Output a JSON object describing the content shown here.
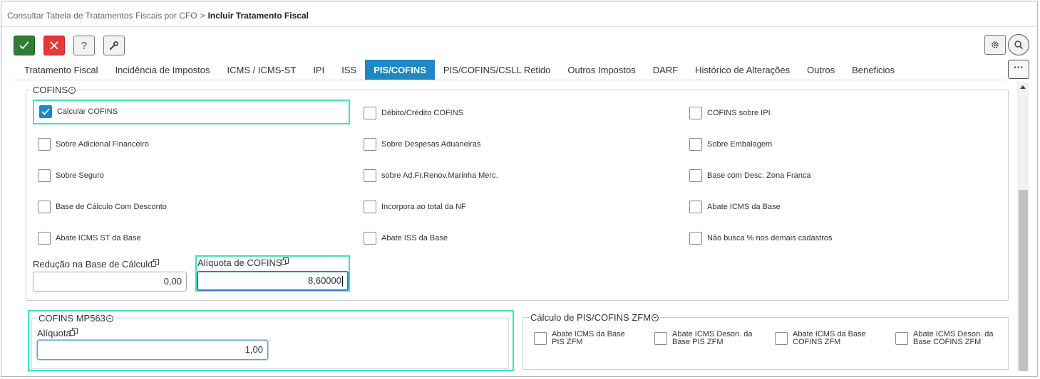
{
  "breadcrumb": {
    "parent": "Consultar Tabela de Tratamentos Fiscais por CFO",
    "separator": ">",
    "current": "Incluir Tratamento Fiscal"
  },
  "toolbar": {
    "confirm_icon": "check-icon",
    "cancel_icon": "close-icon",
    "help_label": "?",
    "tool_icon": "wrench-icon"
  },
  "top_right": {
    "settings_icon": "gear-icon",
    "search_icon": "search-icon",
    "more_label": "···"
  },
  "tabs": [
    {
      "label": "Tratamento Fiscal",
      "active": false
    },
    {
      "label": "Incidência de Impostos",
      "active": false
    },
    {
      "label": "ICMS / ICMS-ST",
      "active": false
    },
    {
      "label": "IPI",
      "active": false
    },
    {
      "label": "ISS",
      "active": false
    },
    {
      "label": "PIS/COFINS",
      "active": true
    },
    {
      "label": "PIS/COFINS/CSLL Retido",
      "active": false
    },
    {
      "label": "Outros Impostos",
      "active": false
    },
    {
      "label": "DARF",
      "active": false
    },
    {
      "label": "Histórico de Alterações",
      "active": false
    },
    {
      "label": "Outros",
      "active": false
    },
    {
      "label": "Beneficios",
      "active": false
    }
  ],
  "cofins": {
    "legend": "COFINS",
    "checkboxes": [
      {
        "label": "Calcular COFINS",
        "checked": true
      },
      {
        "label": "Débito/Crédito COFINS",
        "checked": false
      },
      {
        "label": "COFINS sobre IPI",
        "checked": false
      },
      {
        "label": "Sobre Adicional Financeiro",
        "checked": false
      },
      {
        "label": "Sobre Despesas Aduaneiras",
        "checked": false
      },
      {
        "label": "Sobre Embalagem",
        "checked": false
      },
      {
        "label": "Sobre Seguro",
        "checked": false
      },
      {
        "label": "sobre Ad.Fr.Renov.Marinha Merc.",
        "checked": false
      },
      {
        "label": "Base com Desc. Zona Franca",
        "checked": false
      },
      {
        "label": "Base de Cálculo Com Desconto",
        "checked": false
      },
      {
        "label": "Incorpora ao total da NF",
        "checked": false
      },
      {
        "label": "Abate ICMS da Base",
        "checked": false
      },
      {
        "label": "Abate ICMS ST da Base",
        "checked": false
      },
      {
        "label": "Abate ISS da Base",
        "checked": false
      },
      {
        "label": "Não busca % nos demais cadastros",
        "checked": false
      }
    ],
    "reducao_label": "Redução na Base de Cálculo",
    "reducao_value": "0,00",
    "aliquota_label": "Alíquota de COFINS",
    "aliquota_value": "8,60000"
  },
  "cofins_mp563": {
    "legend": "COFINS MP563",
    "aliquota_label": "Alíquota",
    "aliquota_value": "1,00"
  },
  "zfm": {
    "legend": "Cálculo de PIS/COFINS ZFM",
    "checkboxes": [
      {
        "label": "Abate ICMS da Base PIS ZFM",
        "checked": false
      },
      {
        "label": "Abate ICMS Deson. da Base PIS ZFM",
        "checked": false
      },
      {
        "label": "Abate ICMS da Base COFINS ZFM",
        "checked": false
      },
      {
        "label": "Abate ICMS Deson. da Base COFINS ZFM",
        "checked": false
      }
    ]
  },
  "colors": {
    "accent": "#1e88c7",
    "highlight": "#3ee6b0",
    "confirm": "#2e7d32",
    "cancel": "#e53935"
  }
}
